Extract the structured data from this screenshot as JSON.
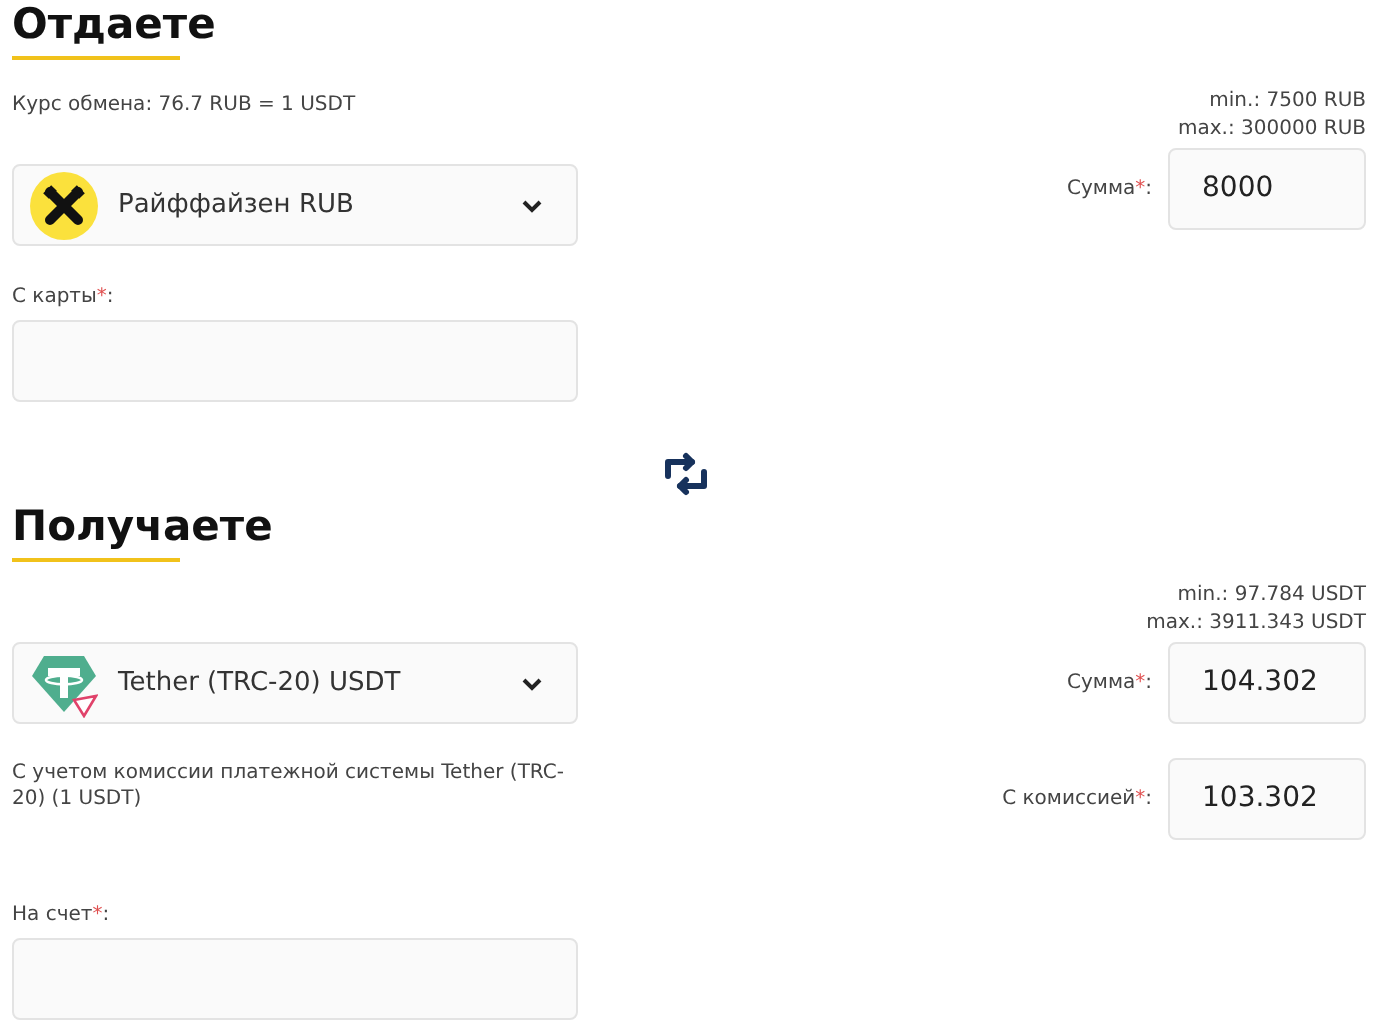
{
  "give": {
    "title": "Отдаете",
    "rate": "Курс обмена: 76.7 RUB = 1 USDT",
    "limits": [
      "min.: 7500 RUB",
      "max.: 300000 RUB"
    ],
    "currency": {
      "kind": "raiffeisen",
      "label": "Райффайзен RUB"
    },
    "amount": {
      "label": "Сумма",
      "mark": "*",
      "suffix": ":",
      "value": "8000"
    },
    "account": {
      "label": "С карты",
      "mark": "*",
      "suffix": ":"
    }
  },
  "receive": {
    "title": "Получаете",
    "limits": [
      "min.: 97.784 USDT",
      "max.: 3911.343 USDT"
    ],
    "currency": {
      "kind": "tether",
      "label": "Tether (TRC-20) USDT"
    },
    "amount": {
      "label": "Сумма",
      "mark": "*",
      "suffix": ":",
      "value": "104.302"
    },
    "note": "С учетом комиссии платежной системы Tether (TRC-20) (1 USDT)",
    "with_fee": {
      "label": "С комиссией",
      "mark": "*",
      "suffix": ":",
      "value": "103.302"
    },
    "account": {
      "label": "На счет",
      "mark": "*",
      "suffix": ":"
    }
  }
}
